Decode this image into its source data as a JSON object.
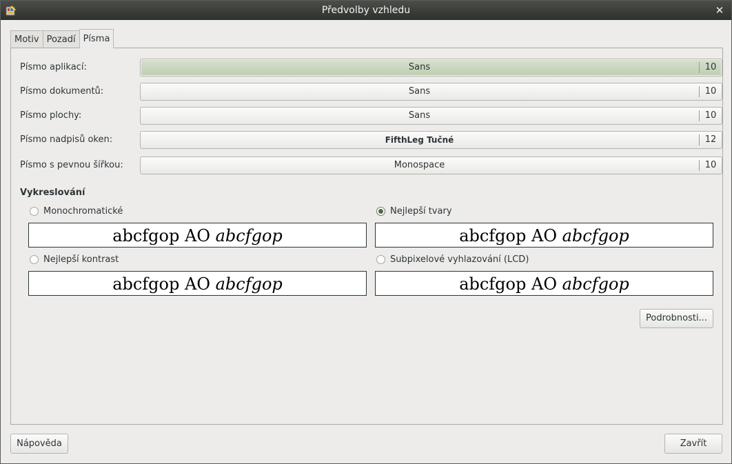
{
  "window": {
    "title": "Předvolby vzhledu",
    "close_glyph": "✕",
    "icon": "appearance-icon"
  },
  "tabs": [
    {
      "label": "Motiv",
      "active": false
    },
    {
      "label": "Pozadí",
      "active": false
    },
    {
      "label": "Písma",
      "active": true
    }
  ],
  "fonts": [
    {
      "label": "Písmo aplikací:",
      "font": "Sans",
      "size": "10"
    },
    {
      "label": "Písmo dokumentů:",
      "font": "Sans",
      "size": "10"
    },
    {
      "label": "Písmo plochy:",
      "font": "Sans",
      "size": "10"
    },
    {
      "label": "Písmo nadpisů oken:",
      "font": "FifthLeg Tučné",
      "size": "12"
    },
    {
      "label": "Písmo s pevnou šířkou:",
      "font": "Monospace",
      "size": "10"
    }
  ],
  "rendering": {
    "title": "Vykreslování",
    "options": [
      {
        "label": "Monochromatické",
        "checked": false
      },
      {
        "label": "Nejlepší tvary",
        "checked": true
      },
      {
        "label": "Nejlepší kontrast",
        "checked": false
      },
      {
        "label": "Subpixelové vyhlazování (LCD)",
        "checked": false
      }
    ],
    "sample_regular": "abcfgop AO ",
    "sample_italic": "abcfgop"
  },
  "buttons": {
    "details": "Podrobnosti...",
    "help": "Nápověda",
    "close": "Zavřít"
  },
  "colors": {
    "titlebar": "#2e302c",
    "selected_button": "#c0ceb3",
    "radio_checked": "#4d6a3b"
  }
}
